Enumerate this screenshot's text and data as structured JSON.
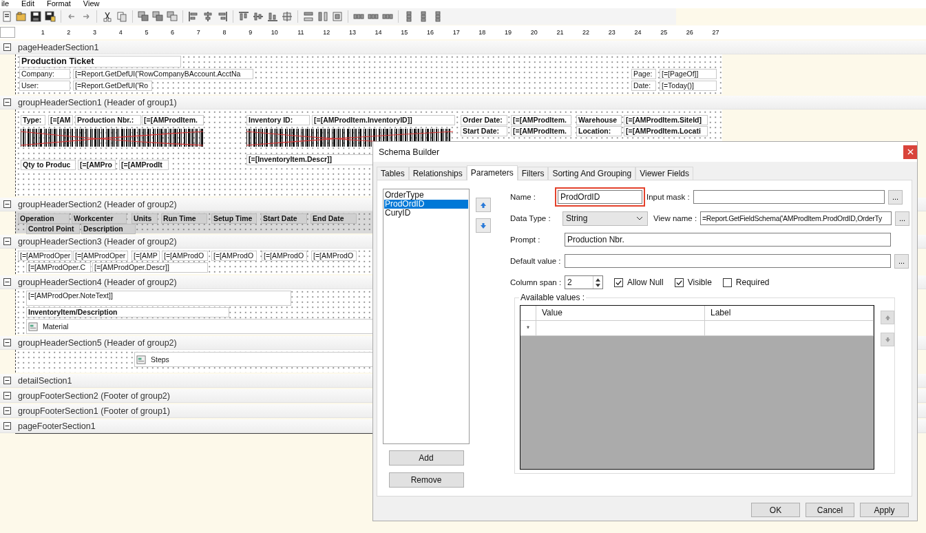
{
  "menu": [
    "ile",
    "Edit",
    "Format",
    "View"
  ],
  "ruler": [
    "1",
    "2",
    "3",
    "4",
    "5",
    "6",
    "7",
    "8",
    "9",
    "10",
    "11",
    "12",
    "13",
    "14",
    "15",
    "16",
    "17",
    "18",
    "19",
    "20",
    "21",
    "22",
    "23",
    "24",
    "25",
    "26",
    "27"
  ],
  "sections": [
    {
      "title": "pageHeaderSection1",
      "controls": [
        {
          "kind": "title",
          "text": "Production Ticket"
        },
        {
          "kind": "expression",
          "text": "Company:"
        },
        {
          "kind": "expression",
          "text": "[=Report.GetDefUI('RowCompanyBAccount.AcctNa"
        },
        {
          "kind": "expression",
          "text": "Page:"
        },
        {
          "kind": "expression",
          "text": "[=[PageOf]]"
        },
        {
          "kind": "expression",
          "text": "User:"
        },
        {
          "kind": "expression",
          "text": "[=Report.GetDefUI('Ro"
        },
        {
          "kind": "expression",
          "text": "Date:"
        },
        {
          "kind": "expression",
          "text": "[=Today()]"
        }
      ]
    },
    {
      "title": "groupHeaderSection1 (Header of group1)",
      "controls": [
        {
          "kind": "caption",
          "text": "Type:"
        },
        {
          "kind": "caption",
          "text": "[=[AM"
        },
        {
          "kind": "caption",
          "text": "Production Nbr.:"
        },
        {
          "kind": "caption",
          "text": "[=[AMProdItem."
        },
        {
          "kind": "barcode"
        },
        {
          "kind": "caption",
          "text": "Inventory ID:"
        },
        {
          "kind": "caption",
          "text": "[=[AMProdItem.InventoryID]]"
        },
        {
          "kind": "barcode"
        },
        {
          "kind": "caption",
          "text": "Order Date:"
        },
        {
          "kind": "caption",
          "text": "[=[AMProdItem."
        },
        {
          "kind": "caption",
          "text": "Warehouse"
        },
        {
          "kind": "caption",
          "text": "[=[AMProdItem.SiteId]"
        },
        {
          "kind": "caption",
          "text": "Start Date:"
        },
        {
          "kind": "caption",
          "text": "[=[AMProdItem."
        },
        {
          "kind": "caption",
          "text": "Location:"
        },
        {
          "kind": "caption",
          "text": "[=[AMProdItem.Locati"
        },
        {
          "kind": "caption",
          "text": "Qty to Produc"
        },
        {
          "kind": "caption",
          "text": "[=[AMPro"
        },
        {
          "kind": "caption",
          "text": "[=[AMProdIt"
        },
        {
          "kind": "caption",
          "text": "[=[InventoryItem.Descr]]"
        }
      ]
    },
    {
      "title": "groupHeaderSection2 (Header of group2)",
      "controls": [
        {
          "kind": "header",
          "text": "Operation"
        },
        {
          "kind": "header",
          "text": "Workcenter"
        },
        {
          "kind": "header",
          "text": "Units"
        },
        {
          "kind": "header",
          "text": "Run Time"
        },
        {
          "kind": "header",
          "text": "Setup Time"
        },
        {
          "kind": "header",
          "text": "Start Date"
        },
        {
          "kind": "header",
          "text": "End Date"
        },
        {
          "kind": "header",
          "text": "Control Point"
        },
        {
          "kind": "header",
          "text": "Description"
        }
      ]
    },
    {
      "title": "groupHeaderSection3 (Header of group2)",
      "controls": [
        {
          "kind": "expression",
          "text": "[=[AMProdOper"
        },
        {
          "kind": "expression",
          "text": "[=[AMProdOper"
        },
        {
          "kind": "expression",
          "text": "[=[AMP"
        },
        {
          "kind": "expression",
          "text": "[=[AMProdO"
        },
        {
          "kind": "expression",
          "text": "[=[AMProdO"
        },
        {
          "kind": "expression",
          "text": "[=[AMProdO"
        },
        {
          "kind": "expression",
          "text": "[=[AMProdO"
        },
        {
          "kind": "expression",
          "text": "[=[AMProdOper.C"
        },
        {
          "kind": "expression",
          "text": "[=[AMProdOper.Descr]]"
        }
      ]
    },
    {
      "title": "groupHeaderSection4 (Header of group2)",
      "controls": [
        {
          "kind": "expression",
          "text": "[=[AMProdOper.NoteText]]"
        },
        {
          "kind": "caption",
          "text": "InventoryItem/Description"
        },
        {
          "kind": "subreport",
          "text": "Material"
        }
      ]
    },
    {
      "title": "groupHeaderSection5 (Header of group2)",
      "controls": [
        {
          "kind": "subreport",
          "text": "Steps"
        }
      ]
    },
    {
      "title": "detailSection1"
    },
    {
      "title": "groupFooterSection2 (Footer of group2)"
    },
    {
      "title": "groupFooterSection1 (Footer of group1)"
    },
    {
      "title": "pageFooterSection1"
    }
  ],
  "dialog": {
    "title": "Schema Builder",
    "tabs": [
      {
        "label": "Tables",
        "selected": false
      },
      {
        "label": "Relationships",
        "selected": false
      },
      {
        "label": "Parameters",
        "selected": true
      },
      {
        "label": "Filters",
        "selected": false
      },
      {
        "label": "Sorting And Grouping",
        "selected": false
      },
      {
        "label": "Viewer Fields",
        "selected": false
      }
    ],
    "parameters": [
      {
        "label": "OrderType",
        "selected": false
      },
      {
        "label": "ProdOrdID",
        "selected": true
      },
      {
        "label": "CuryID",
        "selected": false
      }
    ],
    "list_buttons": [
      "Add",
      "Remove"
    ],
    "name": {
      "label": "Name :",
      "value": "ProdOrdID",
      "highlighted": true
    },
    "input_mask": {
      "label": "Input mask :",
      "browse": "..."
    },
    "data_type": {
      "label": "Data Type :",
      "value": "String"
    },
    "view_name": {
      "label": "View name :",
      "value": "=Report.GetFieldSchema('AMProdItem.ProdOrdID,OrderTy",
      "browse": "..."
    },
    "prompt": {
      "label": "Prompt :",
      "value": "Production Nbr."
    },
    "default_value": {
      "label": "Default value :",
      "browse": "..."
    },
    "column_span": {
      "label": "Column span :",
      "value": "2"
    },
    "options": [
      {
        "label": "Allow Null",
        "checked": true
      },
      {
        "label": "Visible",
        "checked": true
      },
      {
        "label": "Required",
        "checked": false
      }
    ],
    "available_values": {
      "label": "Available values :",
      "columns": [
        "Value",
        "Label"
      ],
      "new_row_marker": "*"
    },
    "buttons": [
      "OK",
      "Cancel",
      "Apply"
    ]
  }
}
